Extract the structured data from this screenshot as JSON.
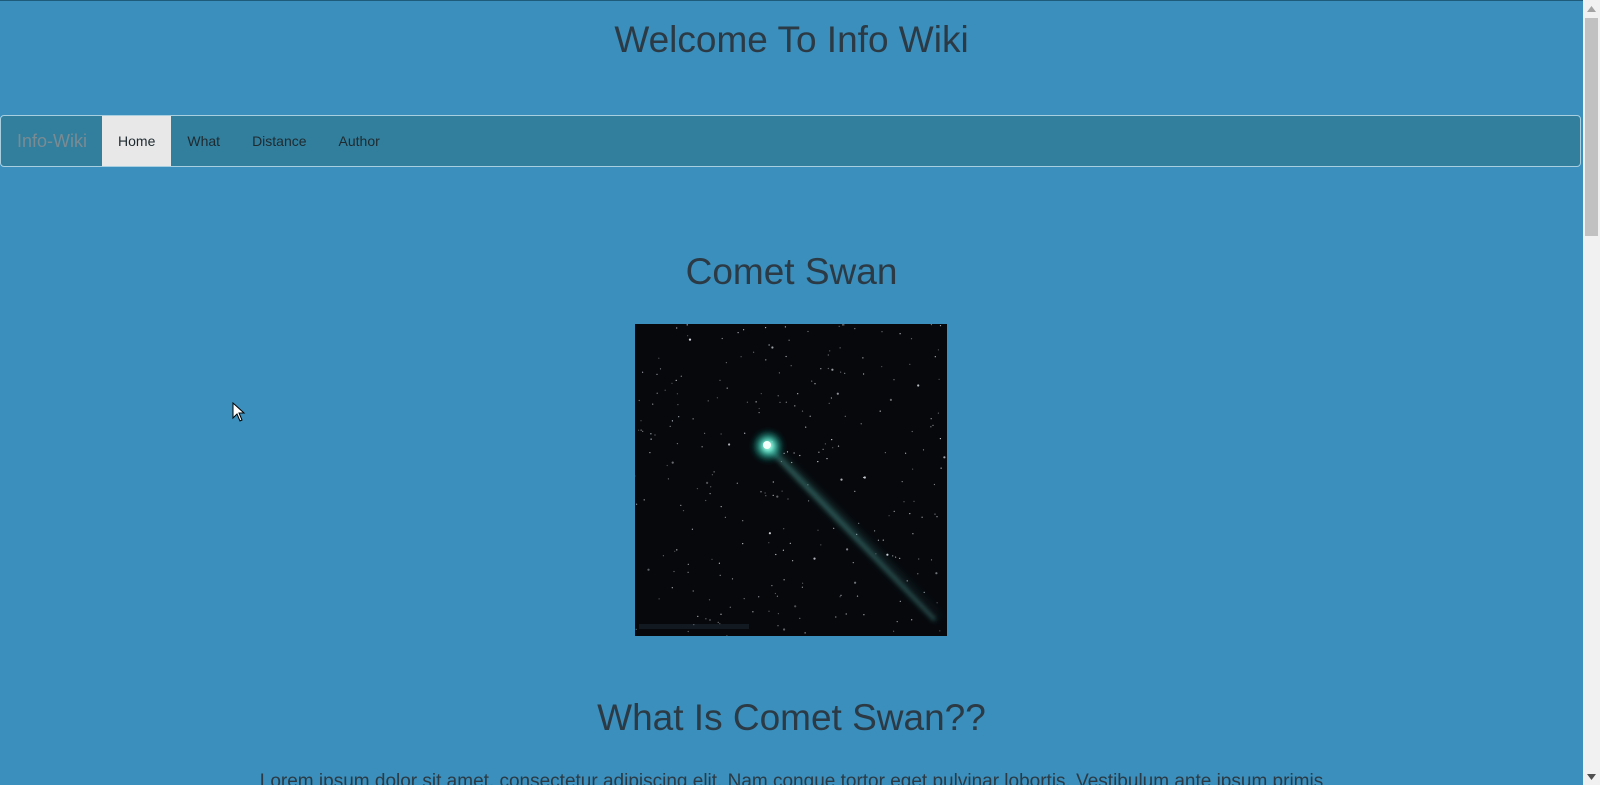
{
  "header": {
    "title": "Welcome To Info Wiki"
  },
  "navbar": {
    "brand": "Info-Wiki",
    "items": [
      {
        "label": "Home",
        "active": true
      },
      {
        "label": "What",
        "active": false
      },
      {
        "label": "Distance",
        "active": false
      },
      {
        "label": "Author",
        "active": false
      }
    ]
  },
  "main": {
    "title": "Comet Swan",
    "section_title": "What Is Comet Swan??",
    "paragraph_start": "Lorem ipsum dolor sit amet, consectetur adipiscing elit. Nam congue tortor eget pulvinar lobortis. Vestibulum ante ipsum primis"
  },
  "colors": {
    "page_background": "#3a8fbd",
    "navbar_background": "#317f9c",
    "active_nav_background": "#e8e8e8",
    "text": "#2b3a44"
  }
}
